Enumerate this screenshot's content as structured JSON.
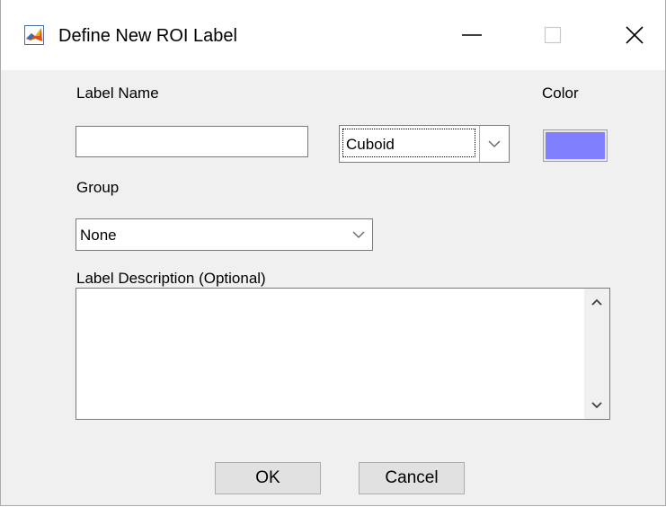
{
  "window": {
    "title": "Define New ROI Label",
    "app_icon": "matlab-logo-icon",
    "controls": [
      "minimize-icon",
      "maximize-icon",
      "close-icon"
    ]
  },
  "form": {
    "label_name_caption": "Label Name",
    "label_name_value": "",
    "type_selected": "Cuboid",
    "color_caption": "Color",
    "color_value": "#8080ff",
    "group_caption": "Group",
    "group_selected": "None",
    "description_caption": "Label Description (Optional)",
    "description_value": ""
  },
  "buttons": {
    "ok_label": "OK",
    "cancel_label": "Cancel"
  },
  "icons": {
    "dropdown": "chevron-down-icon",
    "scroll_up": "chevron-up-icon",
    "scroll_down": "chevron-down-icon"
  }
}
